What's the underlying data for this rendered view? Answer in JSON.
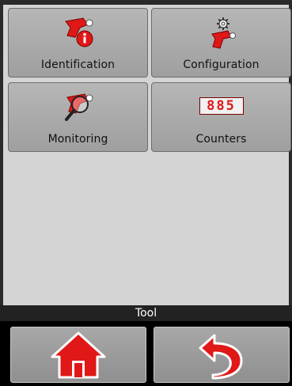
{
  "tiles": [
    {
      "label": "Identification",
      "icon": "identification-icon"
    },
    {
      "label": "Configuration",
      "icon": "configuration-icon"
    },
    {
      "label": "Monitoring",
      "icon": "monitoring-icon"
    },
    {
      "label": "Counters",
      "icon": "counters-icon"
    }
  ],
  "counter_digits": "885",
  "status_bar": {
    "title": "Tool"
  },
  "nav": {
    "home_icon": "home-icon",
    "back_icon": "back-arrow-icon"
  },
  "colors": {
    "accent_red": "#e01818",
    "tile_bg": "#a9a9a9",
    "screen_bg": "#d4d4d4",
    "status_bar_bg": "#222222"
  }
}
